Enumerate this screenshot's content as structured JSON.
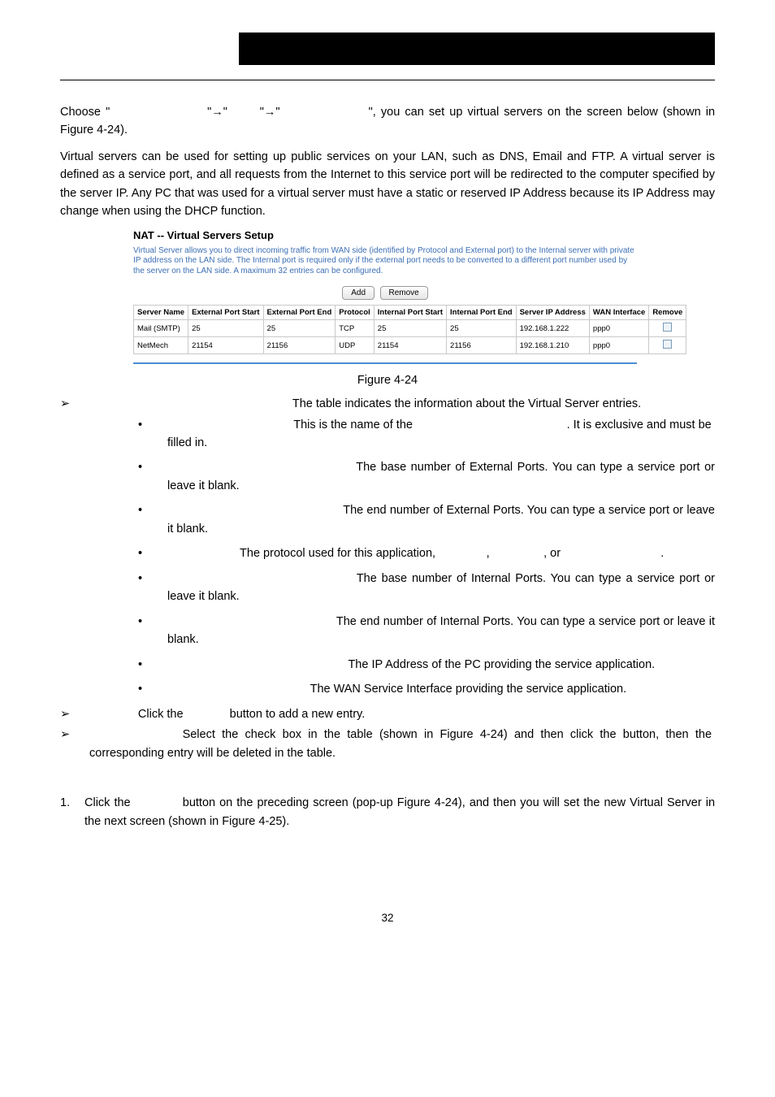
{
  "nav": {
    "choose_prefix": "Choose \"",
    "arrow": "→",
    "quote_arrow_quote": "\"",
    "choose_suffix": "\", you can set up virtual servers on the screen below (shown in Figure 4-24)."
  },
  "para_intro": "Virtual servers can be used for setting up public services on your LAN, such as DNS, Email and FTP. A virtual server is defined as a service port, and all requests from the Internet to this service port will be redirected to the computer specified by the server IP. Any PC that was used for a virtual server must have a static or reserved IP Address because its IP Address may change when using the DHCP function.",
  "figure": {
    "title": "NAT -- Virtual Servers Setup",
    "desc": "Virtual Server allows you to direct incoming traffic from WAN side (identified by Protocol and External port) to the Internal server with private IP address on the LAN side. The Internal port is required only if the external port needs to be converted to a different port number used by the server on the LAN side. A maximum 32 entries can be configured.",
    "btn_add": "Add",
    "btn_remove": "Remove",
    "headers": [
      "Server Name",
      "External Port Start",
      "External Port End",
      "Protocol",
      "Internal Port Start",
      "Internal Port End",
      "Server IP Address",
      "WAN Interface",
      "Remove"
    ],
    "rows": [
      {
        "c": [
          "Mail (SMTP)",
          "25",
          "25",
          "TCP",
          "25",
          "25",
          "192.168.1.222",
          "ppp0",
          ""
        ]
      },
      {
        "c": [
          "NetMech",
          "21154",
          "21156",
          "UDP",
          "21154",
          "21156",
          "192.168.1.210",
          "ppp0",
          ""
        ]
      }
    ],
    "caption": "Figure 4-24"
  },
  "list": {
    "vstable": "The table indicates the information about the Virtual Server entries.",
    "items": [
      {
        "text_a": "This is the name of the ",
        "text_b": ". It is exclusive and must be filled in."
      },
      {
        "text_a": "The base number of External Ports. You can type a service port or leave it blank."
      },
      {
        "text_a": "The end number of External Ports. You can type a service port or leave it blank."
      },
      {
        "text_a": "The protocol used for this application, ",
        "mid1": ", ",
        "mid2": ", or",
        "tail": "."
      },
      {
        "text_a": "The base number of Internal Ports. You can type a service port or leave it blank."
      },
      {
        "text_a": "The end number of Internal Ports. You can type a service port or leave it blank."
      },
      {
        "text_a": "The IP Address of the PC providing the service application."
      },
      {
        "text_a": "The WAN Service Interface providing the service application."
      }
    ],
    "add_line_a": "Click the ",
    "add_line_b": " button to add a new entry.",
    "remove_line": "Select the check box in the table (shown in Figure 4-24) and then click the button, then the corresponding entry will be deleted in the table."
  },
  "num": {
    "n1_a": "Click the ",
    "n1_b": " button on the preceding screen (pop-up Figure 4-24), and then you will set the new Virtual Server in the next screen (shown in Figure 4-25)."
  },
  "pagenum": "32"
}
